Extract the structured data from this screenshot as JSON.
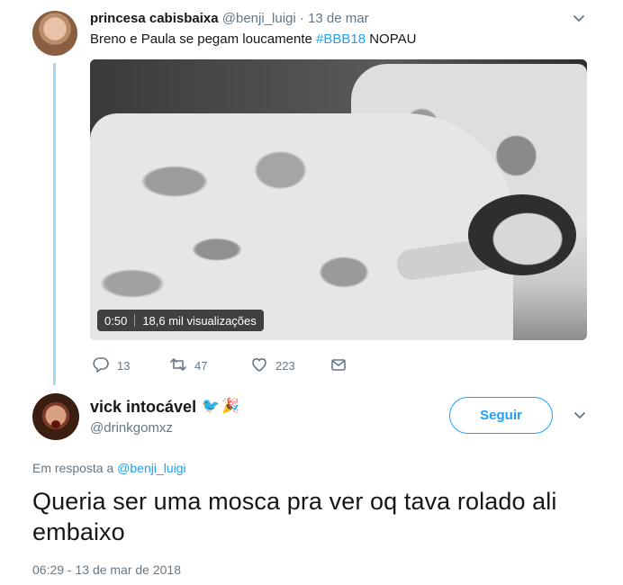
{
  "tweet1": {
    "name": "princesa cabisbaixa",
    "handle": "@benji_luigi",
    "separator": "·",
    "date": "13 de mar",
    "text_before": "Breno e Paula se pegam loucamente ",
    "hashtag": "#BBB18",
    "text_after": " NOPAU",
    "video": {
      "duration": "0:50",
      "views": "18,6 mil visualizações"
    },
    "actions": {
      "replies": "13",
      "retweets": "47",
      "likes": "223"
    }
  },
  "tweet2": {
    "name": "vick intocável",
    "emoji": {
      "bird": "🐦",
      "popper": "🎉"
    },
    "handle": "@drinkgomxz",
    "follow_label": "Seguir",
    "reply_prefix": "Em resposta a ",
    "reply_handle": "@benji_luigi",
    "text": "Queria ser uma mosca pra ver oq tava rolado ali embaixo",
    "timestamp": "06:29 - 13 de mar de 2018"
  },
  "icons": {
    "caret": "chevron-down-icon",
    "reply": "reply-icon",
    "retweet": "retweet-icon",
    "like": "heart-icon",
    "dm": "envelope-icon"
  },
  "colors": {
    "accent": "#1da1f2",
    "muted": "#657786",
    "text": "#14171a",
    "thread_line": "#a3d9ef"
  }
}
